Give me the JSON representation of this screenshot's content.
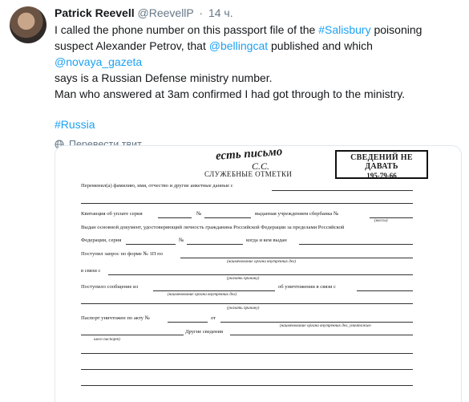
{
  "author": {
    "name": "Patrick Reevell",
    "handle": "@ReevellP",
    "time": "14 ч."
  },
  "tweet": {
    "line1_pre": "I called the phone number on this passport file of the ",
    "hashtag_salisbury": "#Salisbury",
    "line1_post": " poisoning",
    "line2_pre": "suspect Alexander Petrov, that ",
    "mention_bellingcat": "@bellingcat",
    "line2_mid": " published and which ",
    "mention_novaya": "@novaya_gazeta",
    "line3": "says is a Russian Defense ministry number.",
    "line4": "Man who answered at 3am confirmed I had got through to the ministry.",
    "hashtag_russia": "#Russia"
  },
  "translate_label": "Перевести твит",
  "document": {
    "handwritten": "есть письмо",
    "handwritten_initials": "С.С.",
    "stamp_line1": "СВЕДЕНИЙ НЕ ДАВАТЬ",
    "stamp_line2": "195-79-66",
    "title": "СЛУЖЕБНЫЕ ОТМЕТКИ",
    "rows": [
      "Переменил(а) фамилию, имя, отчество и другие анкетные данные с",
      "Квитанция об уплате серия",
      "№",
      "выданная учреждением сбербанка №",
      "(кассы)",
      "Выдан основной документ, удостоверяющий личность гражданина Российской Федерации за пределами Российской",
      "Федерации, серия",
      "№",
      "когда и кем выдан",
      "Поступил запрос по форме № 1П по",
      "(наименование органа внутренних дел)",
      "в связи с",
      "(указать причину)",
      "Поступило сообщение из",
      "об уничтожении в связи с",
      "(наименование органа внутренних дел)",
      "(указать причину)",
      "Паспорт уничтожен по акту №",
      "от",
      "(наименование органа внутренних дел, уничтожив-",
      "шего паспорт)",
      "Другие сведения"
    ]
  }
}
